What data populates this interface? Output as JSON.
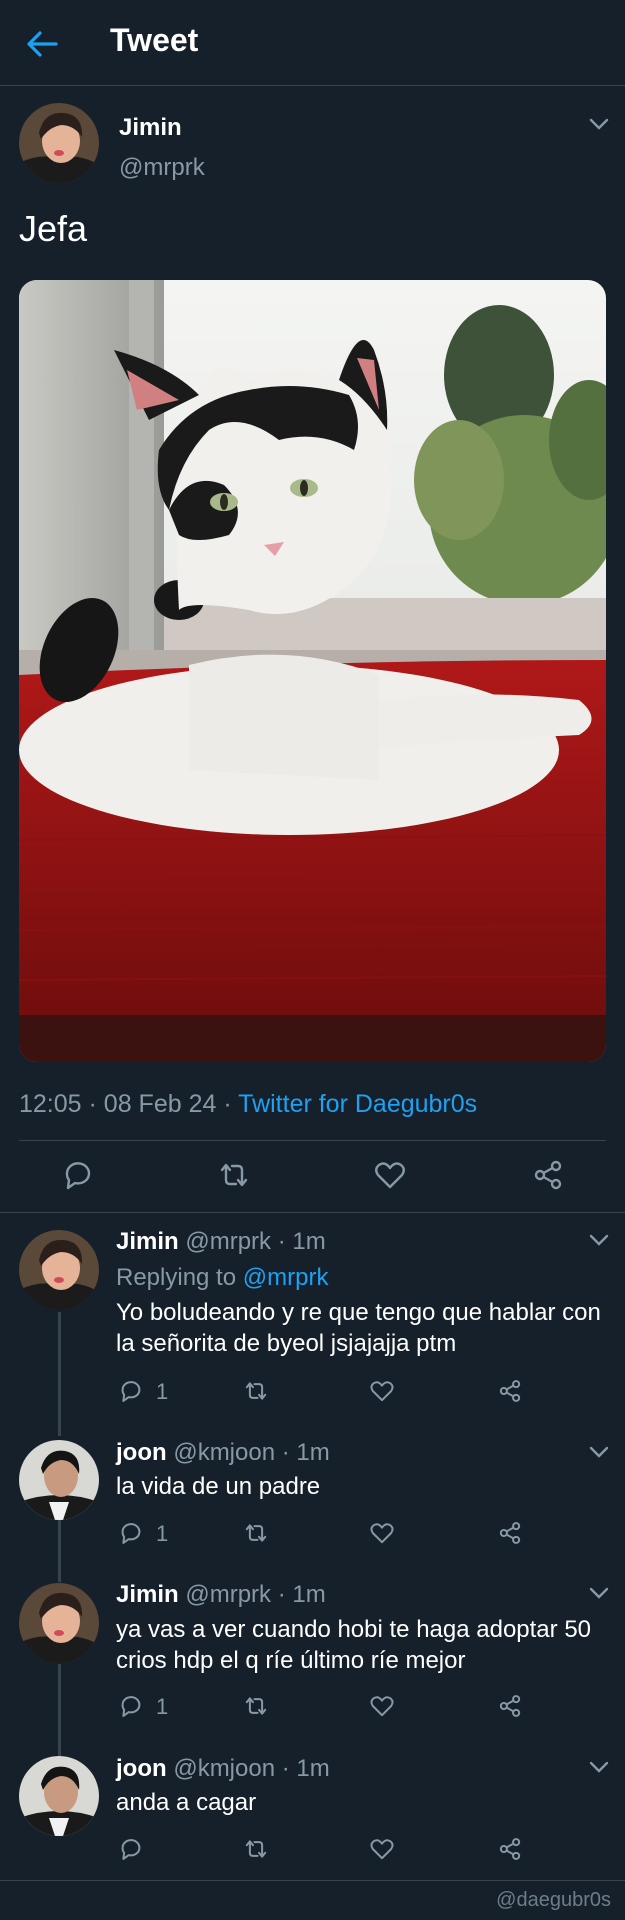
{
  "header": {
    "title": "Tweet",
    "back_icon": "arrow-left-icon"
  },
  "tweet": {
    "author_name": "Jimin",
    "author_handle": "@mrprk",
    "text": "Jefa",
    "time": "12:05",
    "date": "08 Feb 24",
    "source": "Twitter for Daegubr0s",
    "separator": "·"
  },
  "replies": [
    {
      "name": "Jimin",
      "handle": "@mrprk",
      "time": "1m",
      "replying_label": "Replying to",
      "replying_to": "@mrprk",
      "text": "Yo boludeando y re que tengo que hablar con la señorita de byeol jsjajajja ptm",
      "reply_count": "1"
    },
    {
      "name": "joon",
      "handle": "@kmjoon",
      "time": "1m",
      "text": "la vida de un padre",
      "reply_count": "1"
    },
    {
      "name": "Jimin",
      "handle": "@mrprk",
      "time": "1m",
      "text": "ya vas a ver cuando hobi te haga adoptar 50 crios hdp el q ríe último ríe mejor",
      "reply_count": "1"
    },
    {
      "name": "joon",
      "handle": "@kmjoon",
      "time": "1m",
      "text": "anda a cagar",
      "reply_count": ""
    }
  ],
  "watermark": "@daegubr0s",
  "colors": {
    "background": "#15202b",
    "accent": "#1da1f2",
    "muted": "#8899a6",
    "border": "#38444d"
  }
}
